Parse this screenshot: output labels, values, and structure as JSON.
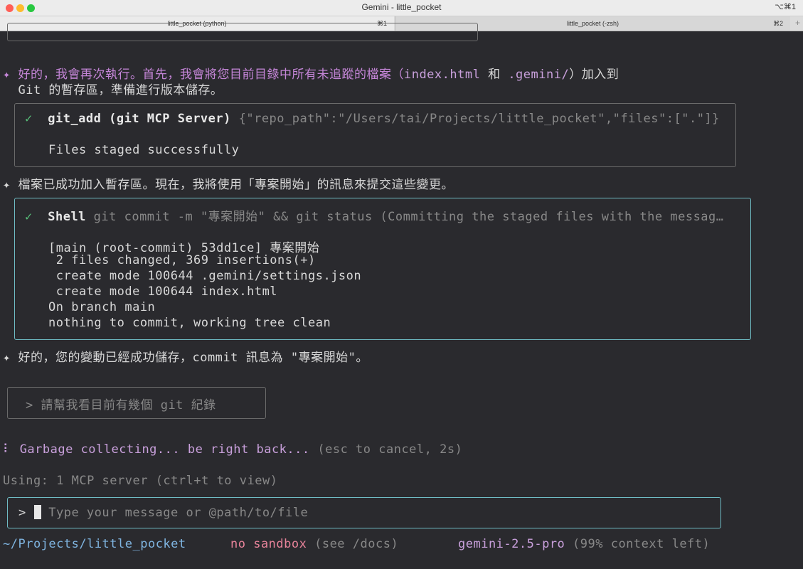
{
  "window": {
    "title": "Gemini - little_pocket",
    "shortcut": "⌥⌘1"
  },
  "tabs": [
    {
      "label": "little_pocket (python)",
      "shortcut": "⌘1"
    },
    {
      "label": "little_pocket (-zsh)",
      "shortcut": "⌘2"
    }
  ],
  "tab_add": "+",
  "messages": {
    "msg1_prefix": "✦ 好的，我會再次執行。首先，我會將您目前目錄中所有未追蹤的檔案（",
    "msg1_file1": "index.html",
    "msg1_mid": " 和 ",
    "msg1_file2": ".gemini/",
    "msg1_suffix": "）加入到",
    "msg1_line2": "  Git 的暫存區，準備進行版本儲存。",
    "msg2": "✦ 檔案已成功加入暫存區。現在，我將使用「專案開始」的訊息來提交這些變更。",
    "msg3": "✦ 好的，您的變動已經成功儲存，commit 訊息為 \"專案開始\"。"
  },
  "tool1": {
    "check": "✓",
    "name": "git_add (git MCP Server)",
    "args": " {\"repo_path\":\"/Users/tai/Projects/little_pocket\",\"files\":[\".\"]}",
    "output": "Files staged successfully"
  },
  "tool2": {
    "check": "✓",
    "name": "Shell",
    "args": " git commit -m \"專案開始\" && git status (Committing the staged files with the messag…",
    "output": [
      "[main (root-commit) 53dd1ce] 專案開始",
      " 2 files changed, 369 insertions(+)",
      " create mode 100644 .gemini/settings.json",
      " create mode 100644 index.html",
      "On branch main",
      "nothing to commit, working tree clean"
    ]
  },
  "queued_prompt": "> 請幫我看目前有幾個 git 紀錄",
  "status": {
    "spinner": "⠇",
    "text": " Garbage collecting... be right back...",
    "hint": " (esc to cancel, 2s)"
  },
  "mcp_line": "Using: 1 MCP server (ctrl+t to view)",
  "input": {
    "prompt": ">",
    "placeholder": "Type your message or @path/to/file"
  },
  "footer": {
    "cwd": "~/Projects/little_pocket",
    "sandbox": "no sandbox",
    "sandbox_hint": " (see /docs)",
    "model": "gemini-2.5-pro",
    "context": " (99% context left)"
  }
}
